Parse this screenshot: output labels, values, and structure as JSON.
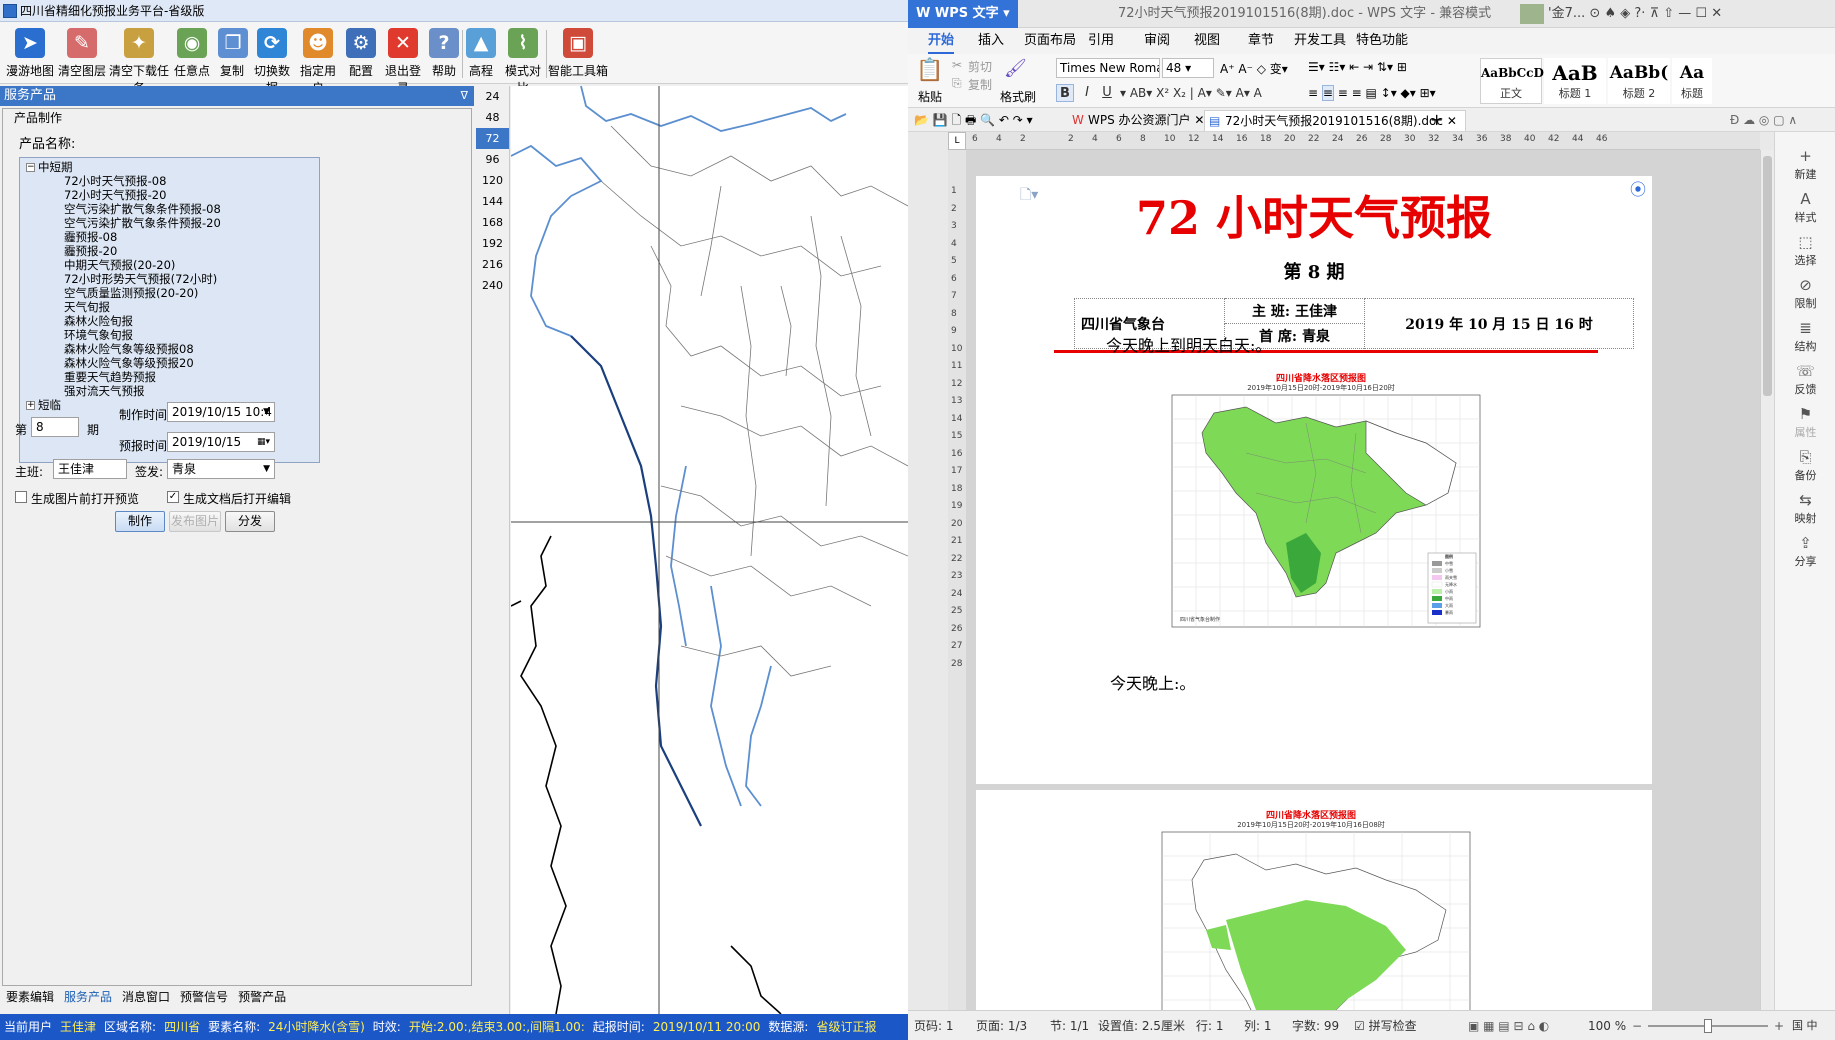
{
  "left_app": {
    "title": "四川省精细化预报业务平台-省级版",
    "toolbar": [
      {
        "label": "漫游地图",
        "icon": "pointer-arrow-icon",
        "color": "#2a6fd0",
        "glyph": "➤"
      },
      {
        "label": "清空图层",
        "icon": "eraser-icon",
        "color": "#d66b6b",
        "glyph": "✎"
      },
      {
        "label": "清空下载任务",
        "icon": "broom-icon",
        "color": "#c9a040",
        "glyph": "✦"
      },
      {
        "label": "任意点",
        "icon": "map-point-icon",
        "color": "#6aa356",
        "glyph": "◉"
      },
      {
        "label": "复制",
        "icon": "copy-icon",
        "color": "#5e8fd3",
        "glyph": "❐"
      },
      {
        "label": "切换数据",
        "icon": "switch-data-icon",
        "color": "#2f86d6",
        "glyph": "⟳"
      },
      {
        "label": "指定用户",
        "icon": "user-icon",
        "color": "#e08a2c",
        "glyph": "☻"
      },
      {
        "label": "配置",
        "icon": "config-icon",
        "color": "#3f6fb8",
        "glyph": "⚙"
      },
      {
        "label": "退出登录",
        "icon": "logout-icon",
        "color": "#e03a2e",
        "glyph": "✕"
      },
      {
        "label": "帮助",
        "icon": "help-icon",
        "color": "#6b8fc8",
        "glyph": "?"
      },
      {
        "label": "高程",
        "icon": "elevation-icon",
        "color": "#5aa0d8",
        "glyph": "▲"
      },
      {
        "label": "模式对比",
        "icon": "model-compare-icon",
        "color": "#6aa356",
        "glyph": "⌇"
      },
      {
        "label": "智能工具箱",
        "icon": "toolbox-icon",
        "color": "#d04a3a",
        "glyph": "▣"
      }
    ],
    "panel_header": "服务产品",
    "group_label": "产品制作",
    "product_name_label": "产品名称:",
    "tree": {
      "root1": "中短期",
      "children": [
        "72小时天气预报-08",
        "72小时天气预报-20",
        "空气污染扩散气象条件预报-08",
        "空气污染扩散气象条件预报-20",
        "霾预报-08",
        "霾预报-20",
        "中期天气预报(20-20)",
        "72小时形势天气预报(72小时)",
        "空气质量监测预报(20-20)",
        "天气旬报",
        "森林火险旬报",
        "环境气象旬报",
        "森林火险气象等级预报08",
        "森林火险气象等级预报20",
        "重要天气趋势预报",
        "强对流天气预报"
      ],
      "root2": "短临"
    },
    "form": {
      "issue_prefix": "第",
      "issue_value": "8",
      "issue_suffix": "期",
      "make_time_label": "制作时间:",
      "make_time_value": "2019/10/15 10:4",
      "report_time_label": "预报时间:",
      "report_time_value": "2019/10/15",
      "duty_label": "主班:",
      "duty_value": "王佳津",
      "sign_label": "签发:",
      "sign_value": "青泉",
      "cb1_label": "生成图片前打开预览",
      "cb1_checked": false,
      "cb2_label": "生成文档后打开编辑",
      "cb2_checked": true,
      "btn_make": "制作",
      "btn_sendimg": "发布图片",
      "btn_dist": "分发"
    },
    "bottom_tabs": [
      "要素编辑",
      "服务产品",
      "消息窗口",
      "预警信号",
      "预警产品"
    ],
    "active_bottom_tab": 1,
    "time_list": [
      "24",
      "48",
      "72",
      "96",
      "120",
      "144",
      "168",
      "192",
      "216",
      "240"
    ],
    "selected_time": "72",
    "status": [
      {
        "t": "当前用户",
        "y": false
      },
      {
        "t": "王佳津",
        "y": true
      },
      {
        "t": "区域名称:",
        "y": false
      },
      {
        "t": "四川省",
        "y": true
      },
      {
        "t": "要素名称:",
        "y": false
      },
      {
        "t": "24小时降水(含雪)",
        "y": true
      },
      {
        "t": "时效:",
        "y": false
      },
      {
        "t": "开始:2.00:,结束3.00:,间隔1.00:",
        "y": true
      },
      {
        "t": "起报时间:",
        "y": false
      },
      {
        "t": "2019/10/11 20:00",
        "y": true
      },
      {
        "t": "数据源:",
        "y": false
      },
      {
        "t": "省级订正报",
        "y": true
      }
    ]
  },
  "wps": {
    "app_name": "WPS 文字",
    "doc_title": "72小时天气预报2019101516(8期).doc - WPS 文字 - 兼容模式",
    "user_short": "'金7...",
    "tabs": [
      "开始",
      "插入",
      "页面布局",
      "引用",
      "审阅",
      "视图",
      "章节",
      "开发工具",
      "特色功能"
    ],
    "ribbon": {
      "paste": "粘贴",
      "cut": "剪切",
      "copy": "复制",
      "format_painter": "格式刷",
      "font_name": "Times New Roman",
      "font_size": "48",
      "styles": [
        {
          "preview": "AaBbCcD",
          "name": "正文"
        },
        {
          "preview": "AaB",
          "name": "标题 1"
        },
        {
          "preview": "AaBb(",
          "name": "标题 2"
        },
        {
          "preview": "Aa",
          "name": "标题"
        }
      ]
    },
    "doc_tabs": [
      "WPS 办公资源门户",
      "72小时天气预报2019101516(8期).doc"
    ],
    "ruler_numbers": [
      "6",
      "4",
      "2",
      "",
      "2",
      "4",
      "6",
      "8",
      "10",
      "12",
      "14",
      "16",
      "18",
      "20",
      "22",
      "24",
      "26",
      "28",
      "30",
      "32",
      "34",
      "36",
      "38",
      "40",
      "42",
      "44",
      "46"
    ],
    "vruler_numbers": [
      "1",
      "2",
      "3",
      "4",
      "5",
      "6",
      "7",
      "8",
      "9",
      "10",
      "11",
      "12",
      "13",
      "14",
      "15",
      "16",
      "17",
      "18",
      "19",
      "20",
      "21",
      "22",
      "23",
      "24",
      "25",
      "26",
      "27",
      "28"
    ],
    "sidebar": [
      {
        "label": "新建",
        "icon": "new-icon",
        "g": "+"
      },
      {
        "label": "样式",
        "icon": "style-icon",
        "g": "A"
      },
      {
        "label": "选择",
        "icon": "select-icon",
        "g": "⬚"
      },
      {
        "label": "限制",
        "icon": "restrict-icon",
        "g": "⊘"
      },
      {
        "label": "结构",
        "icon": "structure-icon",
        "g": "≣"
      },
      {
        "label": "反馈",
        "icon": "feedback-icon",
        "g": "☏"
      },
      {
        "label": "属性",
        "icon": "properties-icon",
        "g": "⚑"
      },
      {
        "label": "备份",
        "icon": "backup-icon",
        "g": "⎘"
      },
      {
        "label": "映射",
        "icon": "mapping-icon",
        "g": "⇆"
      },
      {
        "label": "分享",
        "icon": "share-icon",
        "g": "⇪"
      }
    ],
    "status": {
      "page": "页码: 1",
      "pages": "页面: 1/3",
      "section": "节: 1/1",
      "setting": "设置值: 2.5厘米",
      "row": "行: 1",
      "col": "列: 1",
      "words": "字数: 99",
      "spell": "拼写检查",
      "zoom": "100 %"
    },
    "doc": {
      "title": "72 小时天气预报",
      "issue": "第 8 期",
      "org": "四川省气象台",
      "duty": "主  班: 王佳津",
      "chief": "首  席: 青泉",
      "date": "2019 年 10 月 15 日 16 时",
      "para1": "今天晚上到明天白天:。",
      "para2": "今天晚上:。",
      "map1_title": "四川省降水落区预报图",
      "map1_sub": "2019年10月15日20时-2019年10月16日20时",
      "map1_credit": "四川省气象台制作",
      "map2_title": "四川省降水落区预报图",
      "map2_sub": "2019年10月15日20时-2019年10月16日08时",
      "legend_title": "图例",
      "legend": [
        "中雪",
        "小雪",
        "雨夹雪",
        "无降水",
        "小雨",
        "中雨",
        "大雨",
        "暴雨"
      ]
    }
  },
  "colors": {
    "accent": "#3c77c7",
    "status_bar": "#1c57c8",
    "doc_red": "#e60000",
    "rain_green": "#7ed957"
  }
}
